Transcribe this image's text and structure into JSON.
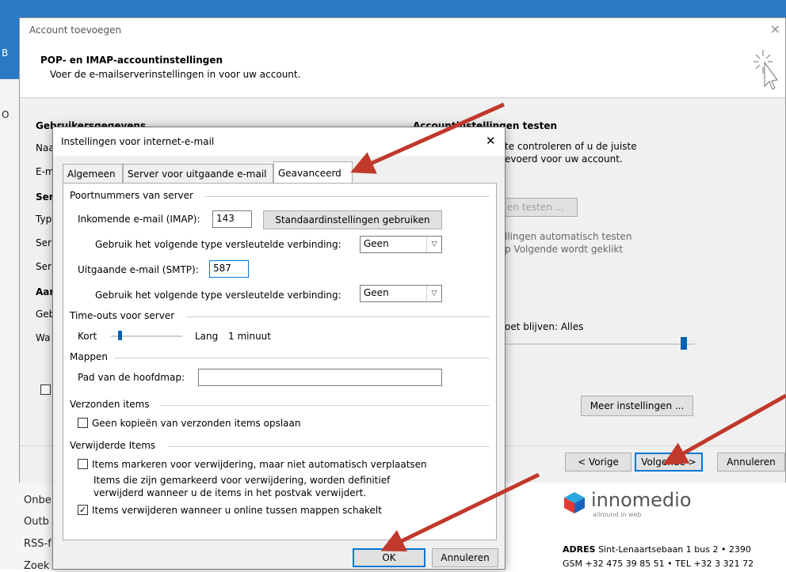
{
  "background": {
    "left_letters": [
      "B",
      "O"
    ],
    "left_items": [
      "Onbe",
      "Outb",
      "RSS-f",
      "Zoek"
    ],
    "ad": {
      "brand": "innomedio",
      "tagline": "allround in web",
      "address_label": "ADRES",
      "address": "Sint-Lenaartsebaan 1 bus 2 • 2390",
      "phone": "GSM +32 475 39 85 51 • TEL +32 3 321 72"
    }
  },
  "account_dialog": {
    "title": "Account toevoegen",
    "close": "×",
    "heading": "POP- en IMAP-accountinstellingen",
    "subheading": "Voer de e-mailserverinstellingen in voor uw account.",
    "left_col": {
      "user_info": "Gebruikersgegevens",
      "fragments": [
        "Naa",
        "E-m",
        "Ser",
        "Typ",
        "Ser",
        "Ser",
        "Aan",
        "Geb",
        "Wa"
      ]
    },
    "right_col": {
      "test_heading": "Accountinstellingen testen",
      "test_text1": "te controleren of u de juiste",
      "test_text2": "evoerd voor uw account.",
      "test_button": "en testen ...",
      "auto_text1": "llingen automatisch testen",
      "auto_text2": "p Volgende wordt geklikt",
      "keep_text": "oet blijven:",
      "keep_value": "Alles",
      "more_settings": "Meer instellingen ..."
    },
    "footer": {
      "back": "< Vorige",
      "next": "Volgende >",
      "cancel": "Annuleren"
    }
  },
  "internet_mail_dialog": {
    "title": "Instellingen voor internet-e-mail",
    "close": "✕",
    "tabs": [
      "Algemeen",
      "Server voor uitgaande e-mail",
      "Geavanceerd"
    ],
    "active_tab": "Geavanceerd",
    "ports": {
      "group": "Poortnummers van server",
      "incoming_label": "Inkomende e-mail (IMAP):",
      "incoming_value": "143",
      "defaults_button": "Standaardinstellingen gebruiken",
      "enc_label_in": "Gebruik het volgende type versleutelde verbinding:",
      "enc_value_in": "Geen",
      "outgoing_label": "Uitgaande e-mail (SMTP):",
      "outgoing_value": "587",
      "enc_label_out": "Gebruik het volgende type versleutelde verbinding:",
      "enc_value_out": "Geen"
    },
    "timeouts": {
      "group": "Time-outs voor server",
      "short": "Kort",
      "long": "Lang",
      "value": "1 minuut",
      "slider_position": 0.1
    },
    "folders": {
      "group": "Mappen",
      "root_label": "Pad van de hoofdmap:",
      "root_value": ""
    },
    "sent": {
      "group": "Verzonden items",
      "no_copies": "Geen kopieën van verzonden items opslaan",
      "no_copies_checked": false
    },
    "deleted": {
      "group": "Verwijderde Items",
      "mark": "Items markeren voor verwijdering, maar niet automatisch verplaatsen",
      "mark_checked": false,
      "note1": "Items die zijn gemarkeerd voor verwijdering, worden definitief",
      "note2": "verwijderd wanneer u de items in het postvak verwijdert.",
      "purge": "Items verwijderen wanneer u online tussen mappen schakelt",
      "purge_checked": true
    },
    "ok": "OK",
    "cancel": "Annuleren"
  },
  "colors": {
    "outlook_blue": "#2b79c2",
    "annotation_arrow": "#c0392b",
    "focus_blue": "#0078d7",
    "slider_blue": "#0063b1"
  }
}
